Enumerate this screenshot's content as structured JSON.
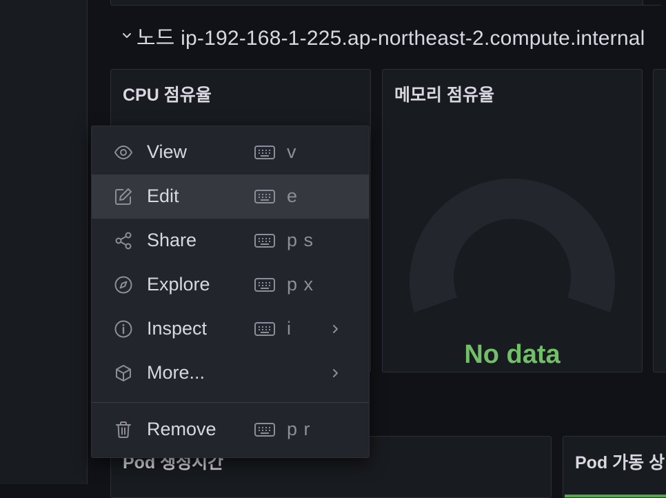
{
  "row": {
    "title": "노드 ip-192-168-1-225.ap-northeast-2.compute.internal"
  },
  "panels": {
    "cpu": {
      "title": "CPU 점유율"
    },
    "memory": {
      "title": "메모리 점유율",
      "no_data": "No data"
    },
    "pod_time": {
      "title": "Pod 생성시간"
    },
    "pod_status": {
      "title": "Pod 가동 상"
    }
  },
  "context_menu": {
    "items": [
      {
        "label": "View",
        "icon": "eye-icon",
        "shortcut": "v"
      },
      {
        "label": "Edit",
        "icon": "edit-icon",
        "shortcut": "e"
      },
      {
        "label": "Share",
        "icon": "share-icon",
        "shortcut": "p s"
      },
      {
        "label": "Explore",
        "icon": "compass-icon",
        "shortcut": "p x"
      },
      {
        "label": "Inspect",
        "icon": "info-icon",
        "shortcut": "i"
      },
      {
        "label": "More...",
        "icon": "cube-icon",
        "shortcut": ""
      },
      {
        "label": "Remove",
        "icon": "trash-icon",
        "shortcut": "p r"
      }
    ],
    "active_item": "Edit"
  },
  "colors": {
    "background": "#111217",
    "panel": "#181b1f",
    "menu": "#22252b",
    "menu_hover": "#35383e",
    "no_data_green": "#73bf69",
    "text": "#d8d9e0",
    "muted": "#8e8e99"
  }
}
